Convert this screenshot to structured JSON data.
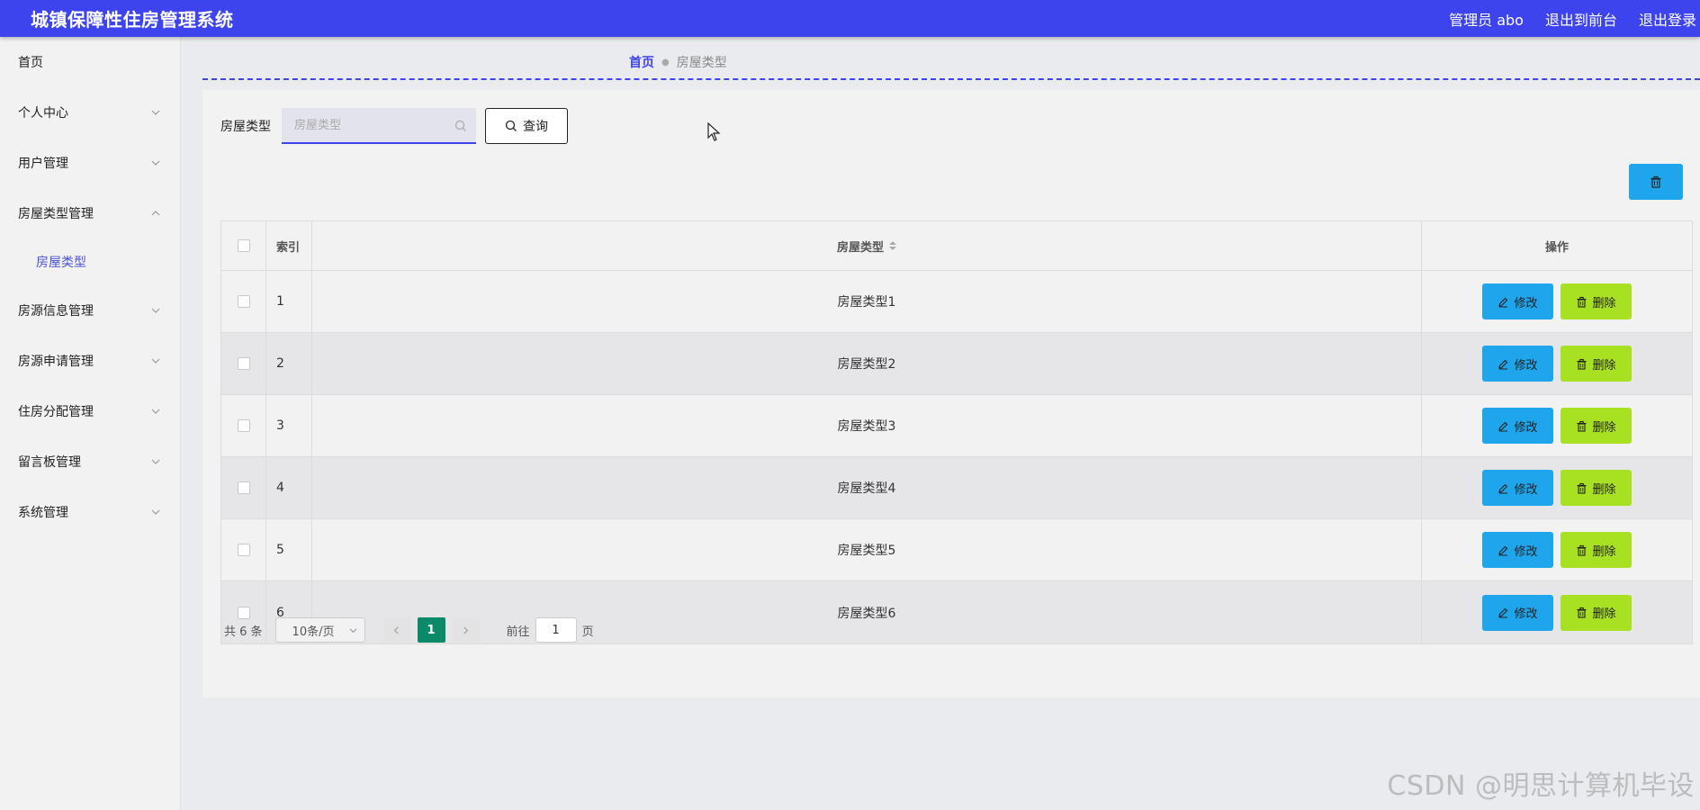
{
  "header": {
    "app_title": "城镇保障性住房管理系统",
    "user_label": "管理员 abo",
    "front_link": "退出到前台",
    "logout_link": "退出登录"
  },
  "sidebar": {
    "items": [
      {
        "label": "首页",
        "has_chevron": false
      },
      {
        "label": "个人中心",
        "has_chevron": true
      },
      {
        "label": "用户管理",
        "has_chevron": true
      },
      {
        "label": "房屋类型管理",
        "has_chevron": true,
        "expanded": true
      },
      {
        "label": "房源信息管理",
        "has_chevron": true
      },
      {
        "label": "房源申请管理",
        "has_chevron": true
      },
      {
        "label": "住房分配管理",
        "has_chevron": true
      },
      {
        "label": "留言板管理",
        "has_chevron": true
      },
      {
        "label": "系统管理",
        "has_chevron": true
      }
    ],
    "submenu": [
      {
        "label": "房屋类型"
      }
    ]
  },
  "breadcrumb": {
    "home": "首页",
    "current": "房屋类型"
  },
  "search": {
    "label": "房屋类型",
    "placeholder": "房屋类型",
    "query_button": "查询"
  },
  "table": {
    "columns": [
      "索引",
      "房屋类型",
      "操作"
    ],
    "rows": [
      {
        "index": "1",
        "type": "房屋类型1"
      },
      {
        "index": "2",
        "type": "房屋类型2"
      },
      {
        "index": "3",
        "type": "房屋类型3"
      },
      {
        "index": "4",
        "type": "房屋类型4"
      },
      {
        "index": "5",
        "type": "房屋类型5"
      },
      {
        "index": "6",
        "type": "房屋类型6"
      }
    ],
    "edit_label": "修改",
    "delete_label": "删除"
  },
  "pagination": {
    "total": "共 6 条",
    "page_size": "10条/页",
    "current_page": "1",
    "goto_prefix": "前往",
    "goto_value": "1",
    "goto_suffix": "页"
  },
  "watermark": "CSDN @明思计算机毕设",
  "colors": {
    "topbar": "#3d44ee",
    "edit_button": "#1ea5ec",
    "delete_button": "#a8e022",
    "active_page": "#0b8a6a"
  }
}
